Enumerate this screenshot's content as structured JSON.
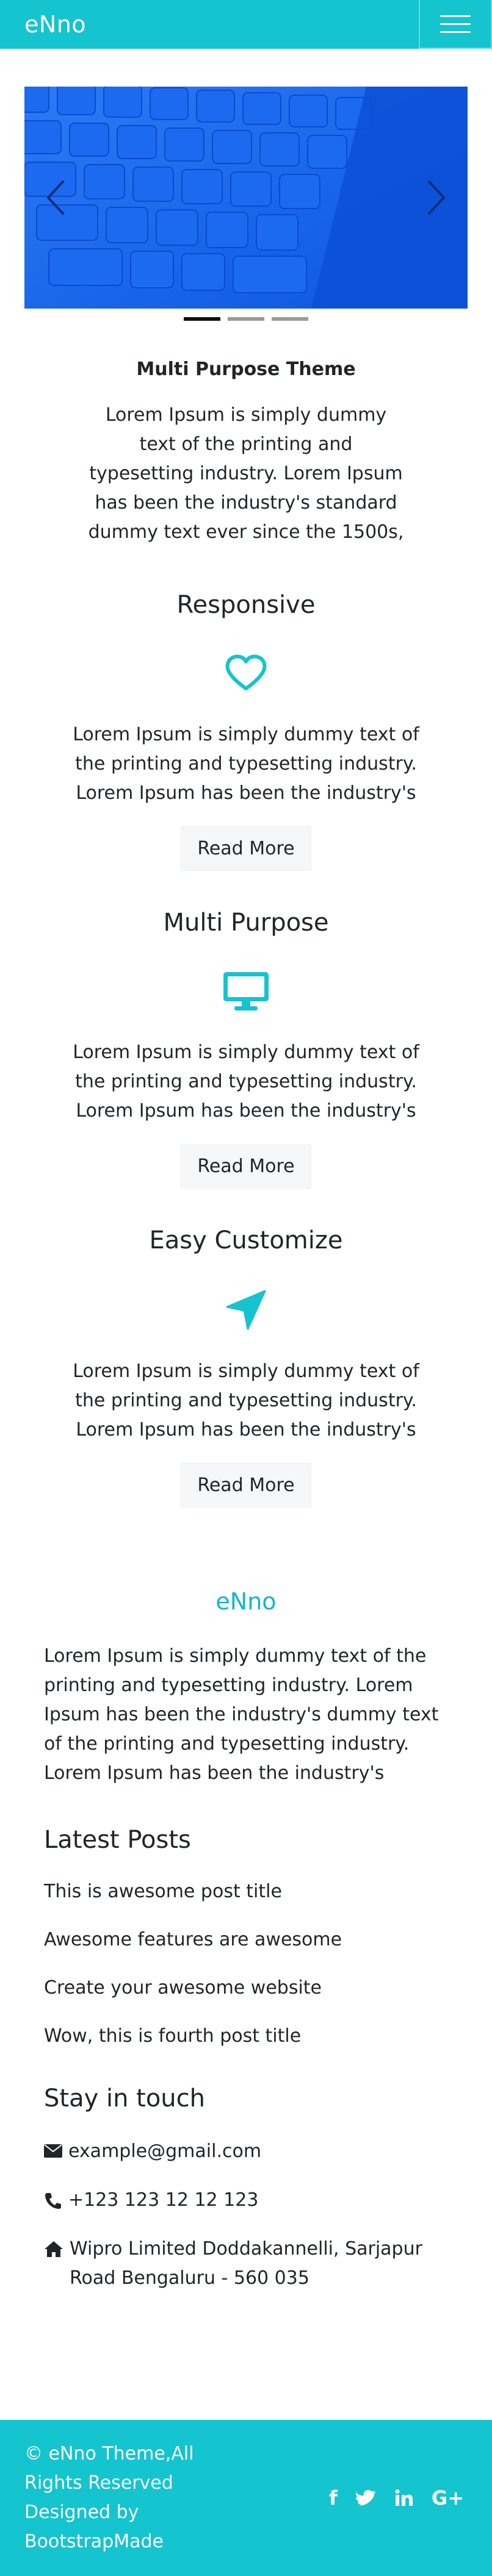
{
  "navbar": {
    "brand": "eNno"
  },
  "colors": {
    "primary": "#14c4cf",
    "accent_text": "#14b6c9",
    "carousel_blue": "#0d5ae8"
  },
  "carousel": {
    "slide_count": 3,
    "active_index": 0
  },
  "intro": {
    "title": "Multi Purpose Theme",
    "text": "Lorem Ipsum is simply dummy text of the printing and typesetting industry. Lorem Ipsum has been the industry's standard dummy text ever since the 1500s,"
  },
  "features": [
    {
      "title": "Responsive",
      "icon": "heart-icon",
      "text": "Lorem Ipsum is simply dummy text of the printing and typesetting industry. Lorem Ipsum has been the industry's",
      "button": "Read More"
    },
    {
      "title": "Multi Purpose",
      "icon": "desktop-icon",
      "text": "Lorem Ipsum is simply dummy text of the printing and typesetting industry. Lorem Ipsum has been the industry's",
      "button": "Read More"
    },
    {
      "title": "Easy Customize",
      "icon": "location-arrow-icon",
      "text": "Lorem Ipsum is simply dummy text of the printing and typesetting industry. Lorem Ipsum has been the industry's",
      "button": "Read More"
    }
  ],
  "footer": {
    "brand": "eNno",
    "about": "Lorem Ipsum is simply dummy text of the printing and typesetting industry. Lorem Ipsum has been the industry's dummy text of the printing and typesetting industry. Lorem Ipsum has been the industry's",
    "latest_posts": {
      "heading": "Latest Posts",
      "items": [
        "This is awesome post title",
        "Awesome features are awesome",
        "Create your awesome website",
        "Wow, this is fourth post title"
      ]
    },
    "contact": {
      "heading": "Stay in touch",
      "email": "example@gmail.com",
      "phone": "+123 123 12 12 123",
      "address": "Wipro Limited Doddakannelli, Sarjapur Road Bengaluru - 560 035"
    },
    "copyright": "© eNno Theme,All Rights Reserved Designed by BootstrapMade",
    "socials": [
      "f",
      "G+"
    ],
    "social_icons": [
      "facebook-icon",
      "twitter-icon",
      "linkedin-icon",
      "google-plus-icon"
    ]
  }
}
